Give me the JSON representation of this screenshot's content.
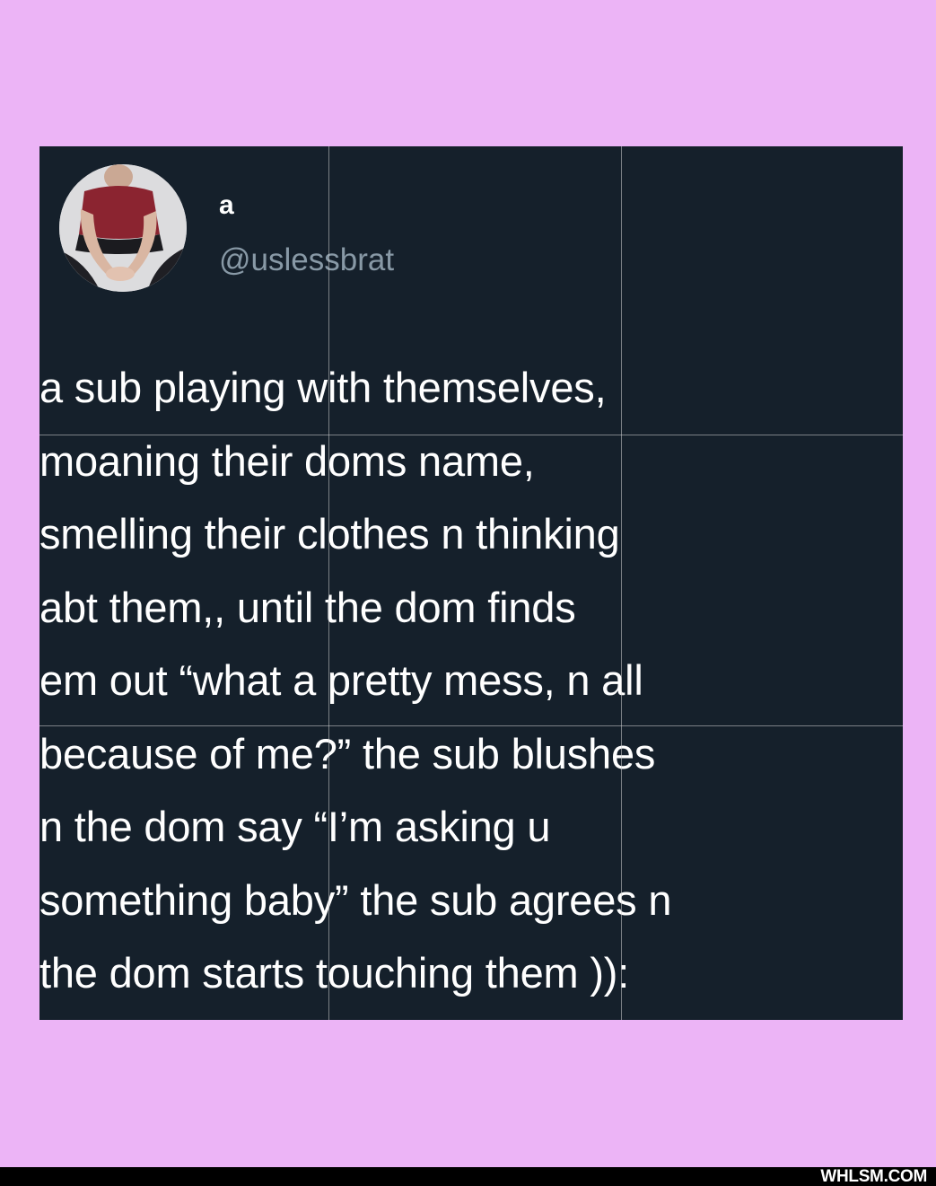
{
  "tweet": {
    "display_name": "a",
    "handle": "@uslessbrat",
    "avatar_icon": "profile-photo-avatar",
    "lines": [
      "a sub playing with themselves,",
      "moaning their doms name,",
      "smelling their clothes n thinking",
      "abt them,, until the dom finds",
      "em out “what a pretty mess, n all",
      "because of me?” the sub blushes",
      "n the dom say “I’m asking u",
      "something baby” the sub agrees n",
      "the dom starts touching them )):"
    ]
  },
  "watermark": {
    "text": "WHLSM.COM"
  },
  "colors": {
    "page_background": "#ecb4f6",
    "card_background": "#15202b",
    "text": "#ffffff",
    "handle": "#8899a6",
    "bottom_bar": "#000000"
  }
}
